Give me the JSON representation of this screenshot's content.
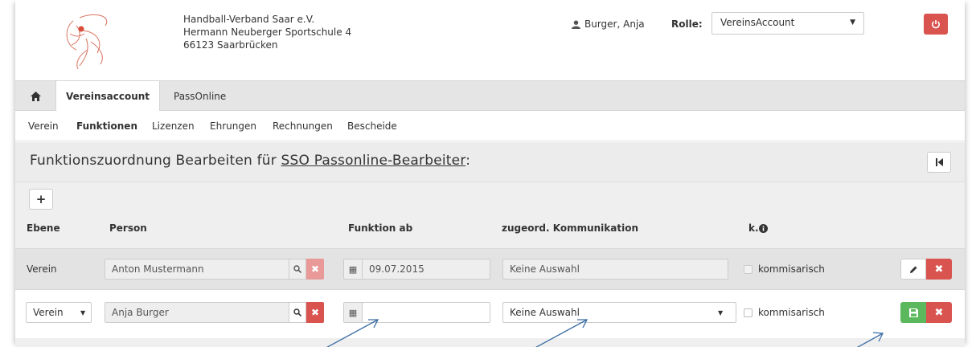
{
  "header": {
    "org_name": "Handball-Verband Saar e.V.",
    "org_street": "Hermann Neuberger Sportschule 4",
    "org_city": "66123 Saarbrücken",
    "user_name": "Burger, Anja",
    "rolle_label": "Rolle:",
    "rolle_value": "VereinsAccount"
  },
  "tabs": [
    {
      "label": "Vereinsaccount",
      "active": true
    },
    {
      "label": "PassOnline",
      "active": false
    }
  ],
  "subnav": [
    "Verein",
    "Funktionen",
    "Lizenzen",
    "Ehrungen",
    "Rechnungen",
    "Bescheide"
  ],
  "section": {
    "title_prefix": "Funktionszuordnung Bearbeiten für ",
    "title_link": "SSO Passonline-Bearbeiter",
    "title_suffix": ":"
  },
  "table": {
    "headers": {
      "ebene": "Ebene",
      "person": "Person",
      "funktion_ab": "Funktion ab",
      "kommunikation": "zugeord. Kommunikation",
      "k": "k."
    },
    "rows": [
      {
        "ebene": "Verein",
        "person": "Anton Mustermann",
        "funktion_ab": "09.07.2015",
        "kommunikation": "Keine Auswahl",
        "kommisarisch_label": "kommisarisch",
        "kommisarisch_checked": false
      },
      {
        "ebene": "Verein",
        "person": "Anja Burger",
        "funktion_ab": "",
        "kommunikation": "Keine Auswahl",
        "kommisarisch_label": "kommisarisch",
        "kommisarisch_checked": false
      }
    ]
  },
  "colors": {
    "danger": "#d9534f",
    "success": "#5cb85c",
    "arrow": "#3a6ea5"
  },
  "icons": [
    "logo-icon",
    "user-icon",
    "power-icon",
    "home-icon",
    "first-page-icon",
    "plus-icon",
    "search-icon",
    "times-icon",
    "calendar-icon",
    "pencil-icon",
    "save-icon",
    "info-icon",
    "caret-down-icon"
  ]
}
